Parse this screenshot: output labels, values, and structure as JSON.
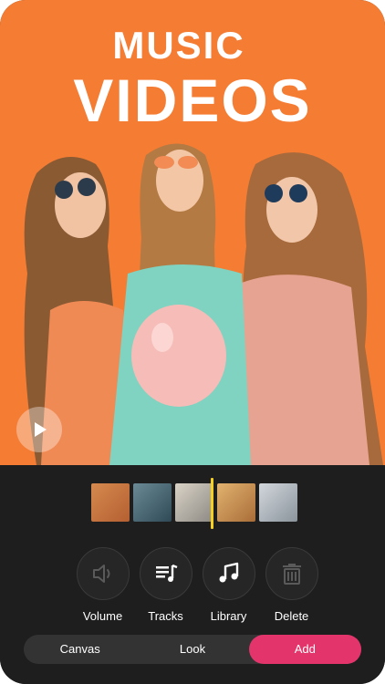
{
  "hero": {
    "headline_line1": "MUSIC",
    "headline_line2": "VIDEOS",
    "background_color": "#f57c33",
    "play_icon": "play-icon"
  },
  "timeline": {
    "clips": [
      {
        "name": "clip-1",
        "color": "#c9733e"
      },
      {
        "name": "clip-2",
        "color": "#4b6b7a"
      },
      {
        "name": "clip-3",
        "color": "#b7b4ad"
      },
      {
        "name": "clip-4",
        "color": "#d09a55"
      },
      {
        "name": "clip-5",
        "color": "#aeb5bd"
      }
    ],
    "playhead_color": "#f5d020"
  },
  "tools": [
    {
      "label": "Volume",
      "icon": "speaker-icon",
      "enabled": false
    },
    {
      "label": "Tracks",
      "icon": "tracks-list-icon",
      "enabled": true
    },
    {
      "label": "Library",
      "icon": "music-note-icon",
      "enabled": true
    },
    {
      "label": "Delete",
      "icon": "trash-icon",
      "enabled": false
    }
  ],
  "tabs": [
    {
      "label": "Canvas",
      "active": false
    },
    {
      "label": "Look",
      "active": false
    },
    {
      "label": "Add",
      "active": true
    }
  ],
  "colors": {
    "accent": "#e3356c",
    "editor_bg": "#1e1e1e"
  }
}
